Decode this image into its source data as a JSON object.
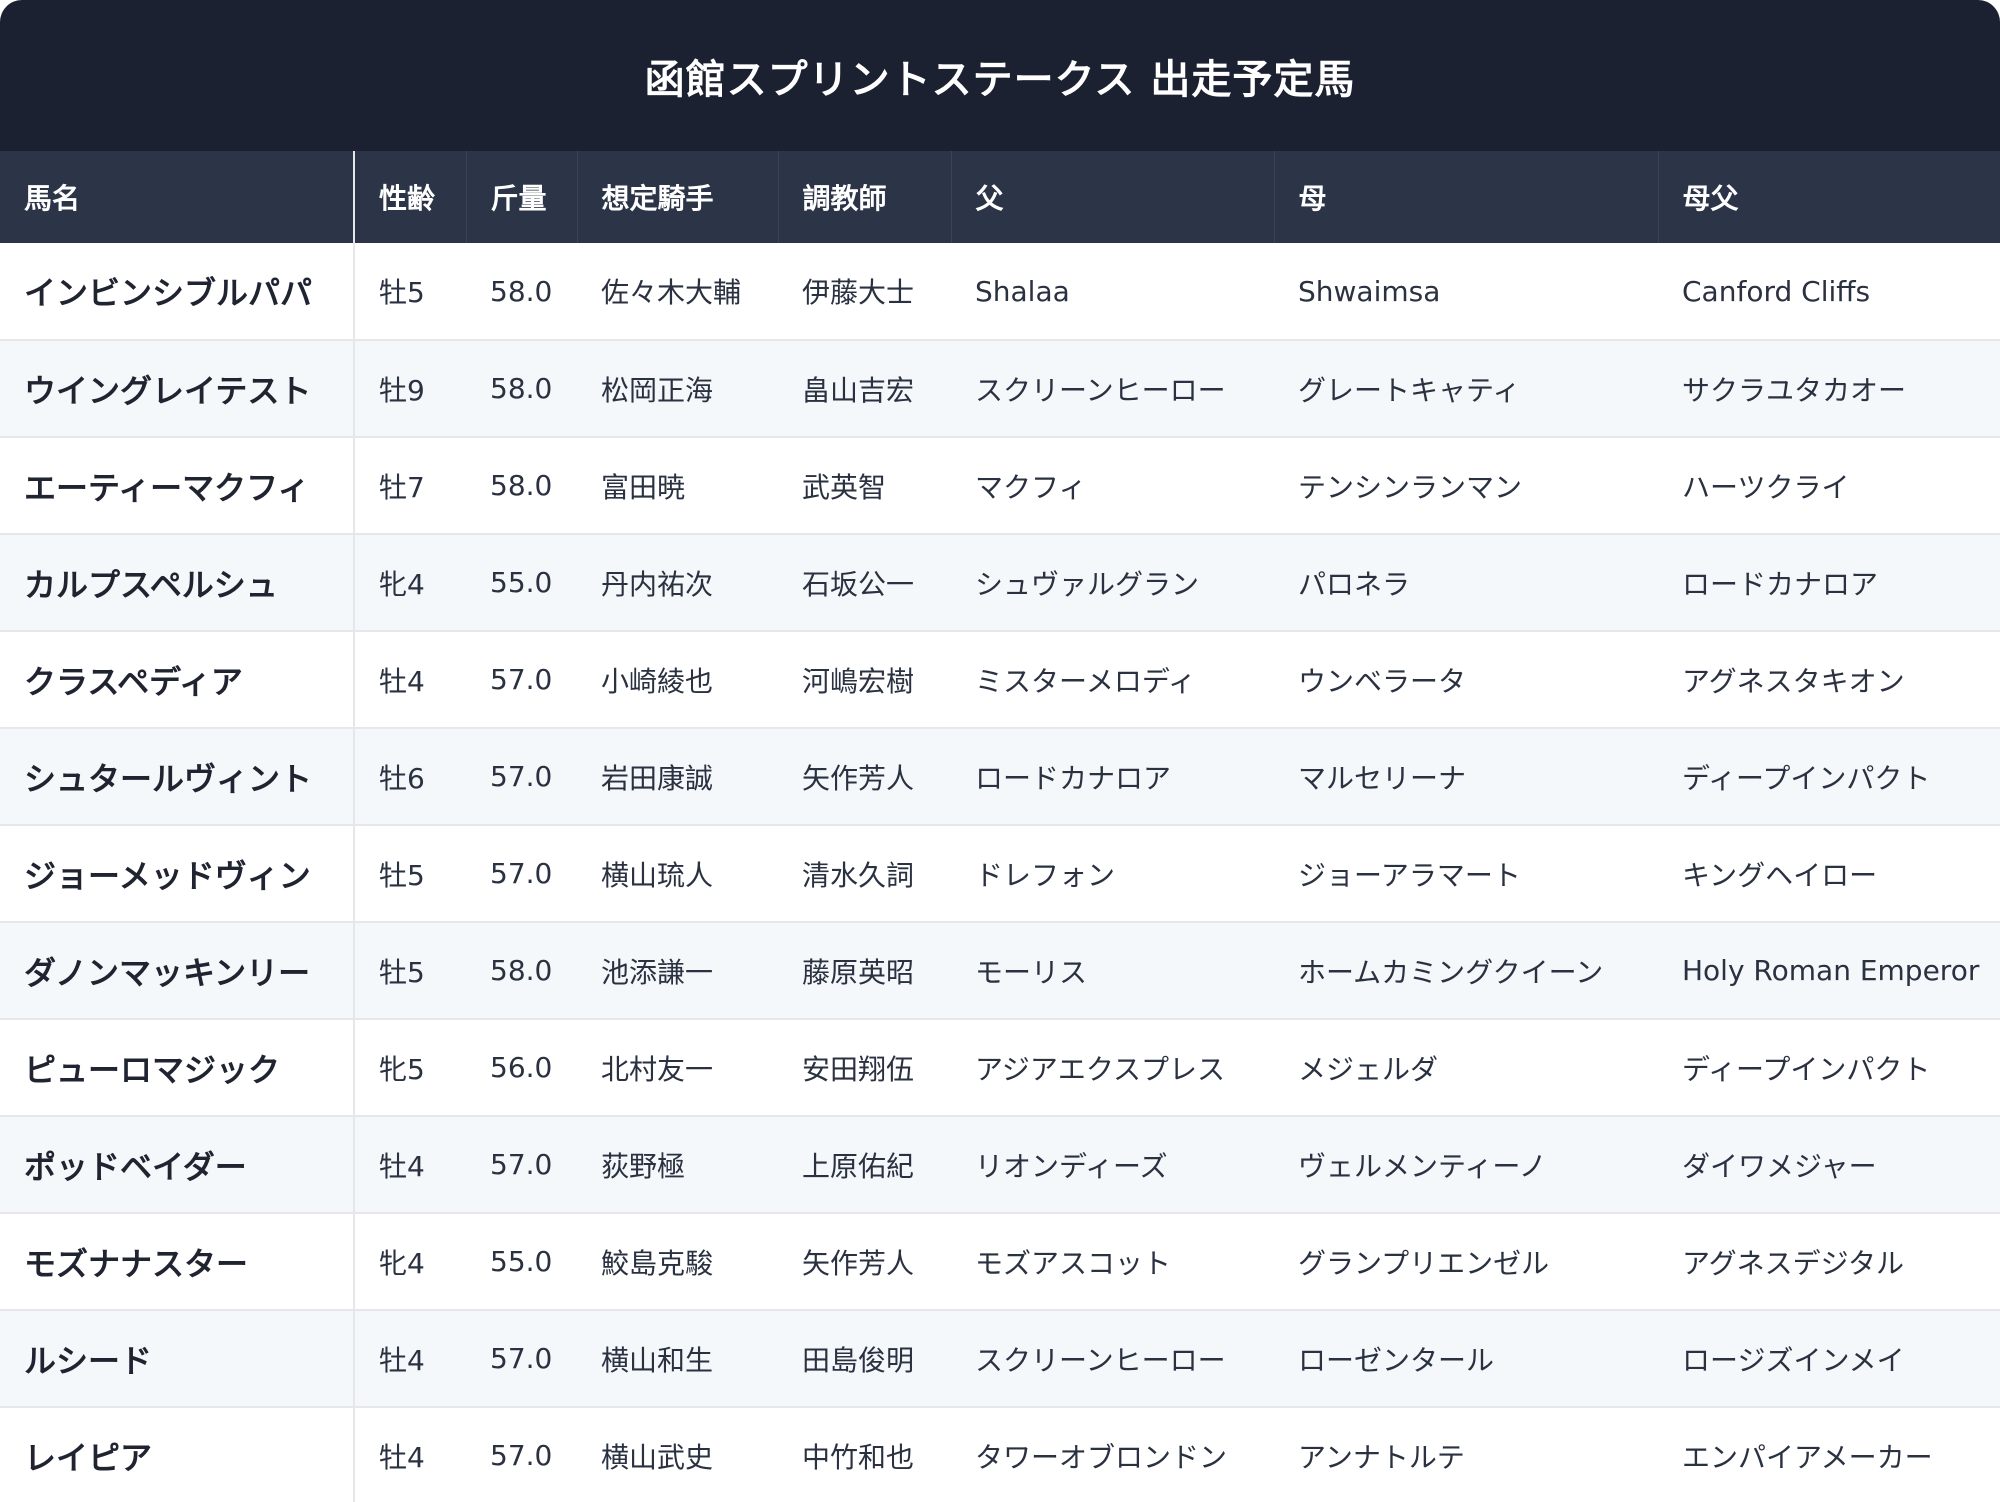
{
  "title": "函館スプリントステークス 出走予定馬",
  "columns": [
    "馬名",
    "性齢",
    "斤量",
    "想定騎手",
    "調教師",
    "父",
    "母",
    "母父"
  ],
  "rows": [
    [
      "インビンシブルパパ",
      "牡5",
      "58.0",
      "佐々木大輔",
      "伊藤大士",
      "Shalaa",
      "Shwaimsa",
      "Canford Cliffs"
    ],
    [
      "ウイングレイテスト",
      "牡9",
      "58.0",
      "松岡正海",
      "畠山吉宏",
      "スクリーンヒーロー",
      "グレートキャティ",
      "サクラユタカオー"
    ],
    [
      "エーティーマクフィ",
      "牡7",
      "58.0",
      "富田暁",
      "武英智",
      "マクフィ",
      "テンシンランマン",
      "ハーツクライ"
    ],
    [
      "カルプスペルシュ",
      "牝4",
      "55.0",
      "丹内祐次",
      "石坂公一",
      "シュヴァルグラン",
      "パロネラ",
      "ロードカナロア"
    ],
    [
      "クラスペディア",
      "牡4",
      "57.0",
      "小崎綾也",
      "河嶋宏樹",
      "ミスターメロディ",
      "ウンベラータ",
      "アグネスタキオン"
    ],
    [
      "シュタールヴィント",
      "牡6",
      "57.0",
      "岩田康誠",
      "矢作芳人",
      "ロードカナロア",
      "マルセリーナ",
      "ディープインパクト"
    ],
    [
      "ジョーメッドヴィン",
      "牡5",
      "57.0",
      "横山琉人",
      "清水久詞",
      "ドレフォン",
      "ジョーアラマート",
      "キングヘイロー"
    ],
    [
      "ダノンマッキンリー",
      "牡5",
      "58.0",
      "池添謙一",
      "藤原英昭",
      "モーリス",
      "ホームカミングクイーン",
      "Holy Roman Emperor"
    ],
    [
      "ピューロマジック",
      "牝5",
      "56.0",
      "北村友一",
      "安田翔伍",
      "アジアエクスプレス",
      "メジェルダ",
      "ディープインパクト"
    ],
    [
      "ポッドベイダー",
      "牡4",
      "57.0",
      "荻野極",
      "上原佑紀",
      "リオンディーズ",
      "ヴェルメンティーノ",
      "ダイワメジャー"
    ],
    [
      "モズナナスター",
      "牝4",
      "55.0",
      "鮫島克駿",
      "矢作芳人",
      "モズアスコット",
      "グランプリエンゼル",
      "アグネスデジタル"
    ],
    [
      "ルシード",
      "牡4",
      "57.0",
      "横山和生",
      "田島俊明",
      "スクリーンヒーロー",
      "ローゼンタール",
      "ロージズインメイ"
    ],
    [
      "レイピア",
      "牡4",
      "57.0",
      "横山武史",
      "中竹和也",
      "タワーオブロンドン",
      "アンナトルテ",
      "エンパイアメーカー"
    ]
  ]
}
